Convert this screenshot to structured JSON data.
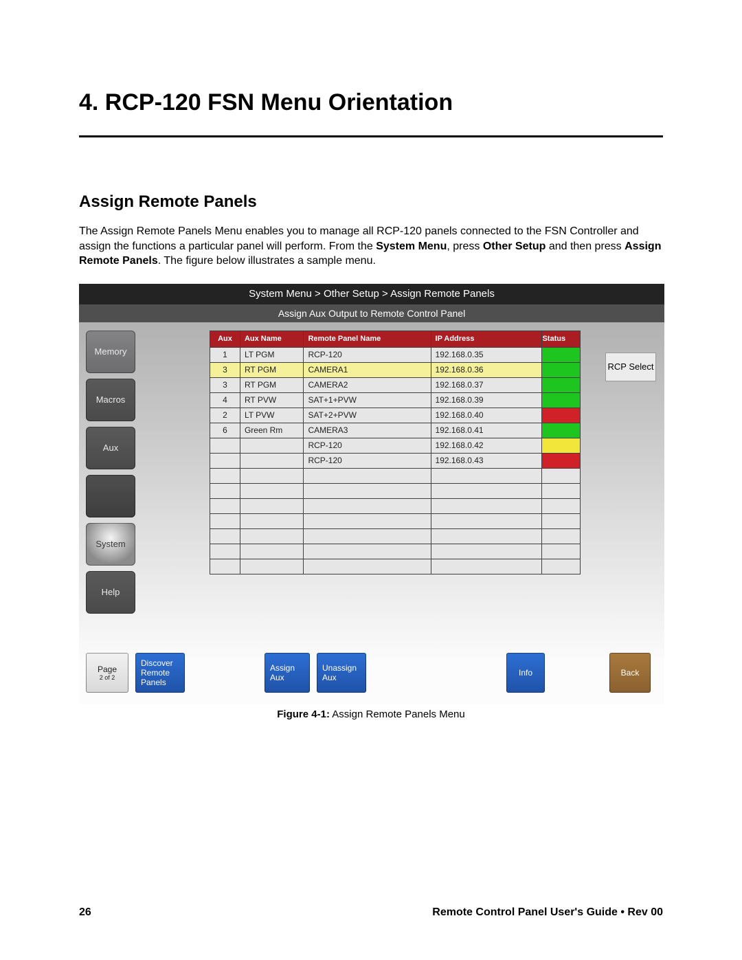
{
  "chapter_title": "4.  RCP-120 FSN Menu Orientation",
  "section_title": "Assign Remote Panels",
  "body_parts": [
    "The Assign Remote Panels Menu enables you to manage all RCP-120 panels connected to the FSN Controller and assign the functions a particular panel will perform. From the ",
    "System Menu",
    ", press ",
    "Other Setup",
    " and then press ",
    "Assign Remote Panels",
    ". The figure below illustrates a sample menu."
  ],
  "screenshot": {
    "breadcrumb": "System Menu > Other Setup > Assign Remote Panels",
    "subtitle": "Assign Aux Output to Remote Control Panel",
    "side_buttons": [
      {
        "label": "Memory",
        "style": "side-btn"
      },
      {
        "label": "Macros",
        "style": "side-btn dark"
      },
      {
        "label": "Aux",
        "style": "side-btn dark"
      },
      {
        "label": "",
        "style": "side-btn blank"
      },
      {
        "label": "System",
        "style": "side-btn bright"
      },
      {
        "label": "Help",
        "style": "side-btn dark"
      }
    ],
    "headers": {
      "aux": "Aux",
      "name": "Aux Name",
      "rpn": "Remote Panel Name",
      "ip": "IP Address",
      "status": "Status"
    },
    "rows": [
      {
        "aux": "1",
        "name": "LT PGM",
        "rpn": "RCP-120",
        "ip": "192.168.0.35",
        "status": "green",
        "sel": false
      },
      {
        "aux": "3",
        "name": "RT PGM",
        "rpn": "CAMERA1",
        "ip": "192.168.0.36",
        "status": "green",
        "sel": true
      },
      {
        "aux": "3",
        "name": "RT PGM",
        "rpn": "CAMERA2",
        "ip": "192.168.0.37",
        "status": "green",
        "sel": false
      },
      {
        "aux": "4",
        "name": "RT PVW",
        "rpn": "SAT+1+PVW",
        "ip": "192.168.0.39",
        "status": "green",
        "sel": false
      },
      {
        "aux": "2",
        "name": "LT PVW",
        "rpn": "SAT+2+PVW",
        "ip": "192.168.0.40",
        "status": "red",
        "sel": false
      },
      {
        "aux": "6",
        "name": "Green Rm",
        "rpn": "CAMERA3",
        "ip": "192.168.0.41",
        "status": "green",
        "sel": false
      },
      {
        "aux": "",
        "name": "",
        "rpn": "RCP-120",
        "ip": "192.168.0.42",
        "status": "yellow",
        "sel": false
      },
      {
        "aux": "",
        "name": "",
        "rpn": "RCP-120",
        "ip": "192.168.0.43",
        "status": "red",
        "sel": false
      }
    ],
    "empty_rows": 7,
    "rcp_select": "RCP Select",
    "bottom": {
      "page_label": "Page",
      "page_sub": "2 of 2",
      "discover": "Discover Remote Panels",
      "assign": "Assign Aux",
      "unassign": "Unassign Aux",
      "info": "Info",
      "back": "Back"
    }
  },
  "caption_bold": "Figure 4-1:",
  "caption_rest": " Assign Remote Panels Menu",
  "footer_left": "26",
  "footer_right": "Remote Control Panel User's Guide • Rev 00"
}
